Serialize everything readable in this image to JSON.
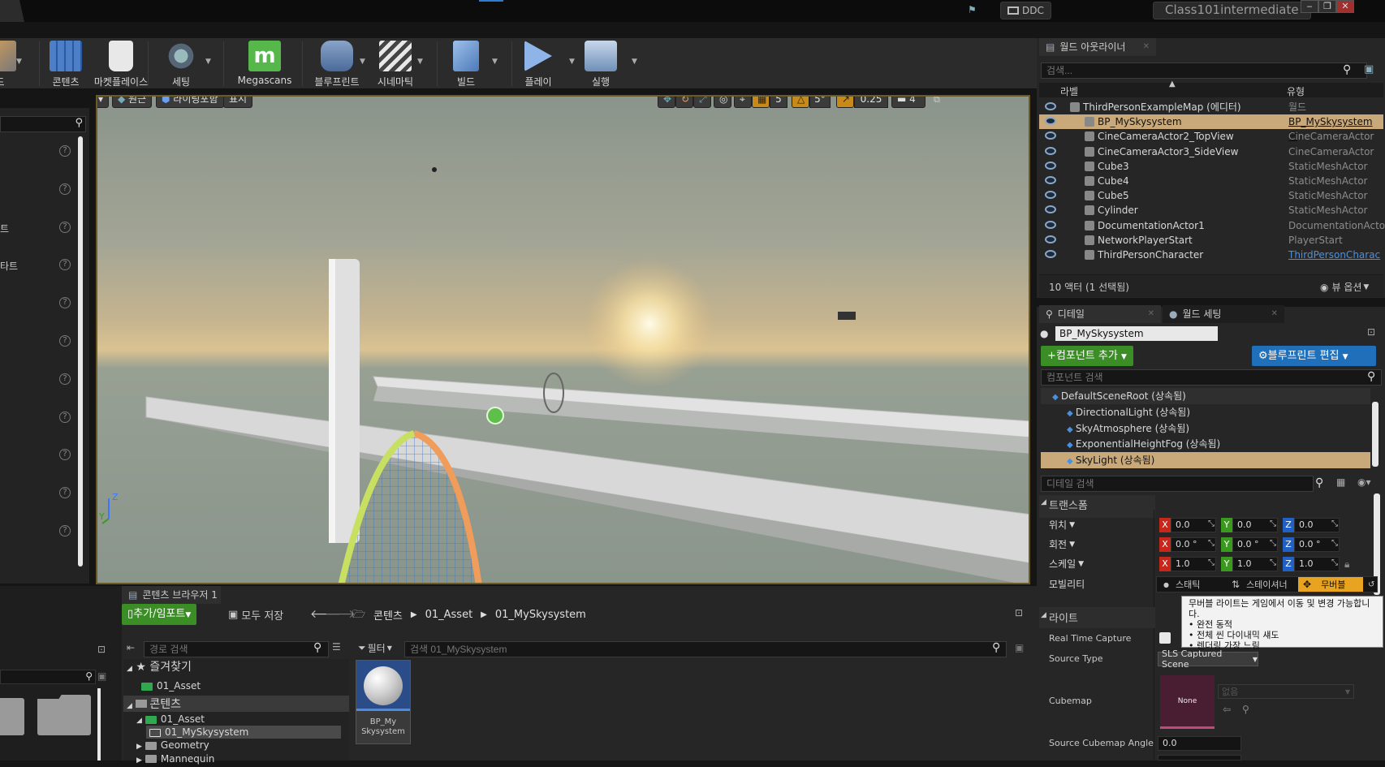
{
  "titlebar": {
    "ddc_label": "DDC",
    "project_name": "Class101intermediate",
    "minimize": "‒",
    "restore": "❐",
    "close": "✕"
  },
  "toolbar": {
    "items": [
      {
        "label": "드",
        "icon": "modes-icon"
      },
      {
        "label": "콘텐츠",
        "icon": "content-icon"
      },
      {
        "label": "마켓플레이스",
        "icon": "marketplace-icon"
      },
      {
        "label": "세팅",
        "icon": "settings-icon"
      },
      {
        "label": "Megascans",
        "icon": "megascans-icon"
      },
      {
        "label": "블루프린트",
        "icon": "blueprint-icon"
      },
      {
        "label": "시네마틱",
        "icon": "cinematics-icon"
      },
      {
        "label": "빌드",
        "icon": "build-icon"
      },
      {
        "label": "플레이",
        "icon": "play-icon"
      },
      {
        "label": "실행",
        "icon": "launch-icon"
      }
    ]
  },
  "left_panel": {
    "items": [
      "",
      "",
      "트",
      "타트",
      "",
      "",
      "",
      "",
      "",
      "",
      ""
    ]
  },
  "viewport": {
    "perspective_label": "원근",
    "lighting_label": "라이팅포함",
    "show_label": "표시",
    "grid_snap": "5",
    "rotation_snap": "5°",
    "scale_snap": "0.25",
    "camera_speed": "4",
    "axis_z": "Z",
    "axis_y": "Y"
  },
  "outliner": {
    "tab_label": "월드 아웃라이너",
    "search_placeholder": "검색...",
    "col_label": "라벨",
    "col_type": "유형",
    "rows": [
      {
        "label": "ThirdPersonExampleMap (에디터)",
        "type": "월드",
        "selected": false,
        "indent": 0
      },
      {
        "label": "BP_MySkysystem",
        "type": "BP_MySkysystem 편",
        "selected": true,
        "indent": 1
      },
      {
        "label": "CineCameraActor2_TopView",
        "type": "CineCameraActor",
        "selected": false,
        "indent": 1
      },
      {
        "label": "CineCameraActor3_SideView",
        "type": "CineCameraActor",
        "selected": false,
        "indent": 1
      },
      {
        "label": "Cube3",
        "type": "StaticMeshActor",
        "selected": false,
        "indent": 1
      },
      {
        "label": "Cube4",
        "type": "StaticMeshActor",
        "selected": false,
        "indent": 1
      },
      {
        "label": "Cube5",
        "type": "StaticMeshActor",
        "selected": false,
        "indent": 1
      },
      {
        "label": "Cylinder",
        "type": "StaticMeshActor",
        "selected": false,
        "indent": 1
      },
      {
        "label": "DocumentationActor1",
        "type": "DocumentationActor",
        "selected": false,
        "indent": 1
      },
      {
        "label": "NetworkPlayerStart",
        "type": "PlayerStart",
        "selected": false,
        "indent": 1
      },
      {
        "label": "ThirdPersonCharacter",
        "type": "ThirdPersonCharac",
        "selected": false,
        "indent": 1
      }
    ],
    "footer_count": "10 액터 (1 선택됨)",
    "view_options": "뷰 옵션"
  },
  "details": {
    "tab_details": "디테일",
    "tab_world_settings": "월드 세팅",
    "actor_name": "BP_MySkysystem",
    "add_component": "컴포넌트 추가",
    "edit_blueprint": "블루프린트 편집",
    "component_search_placeholder": "컴포넌트 검색",
    "components": [
      {
        "label": "DefaultSceneRoot (상속됨)",
        "indent": 0,
        "selected": false
      },
      {
        "label": "DirectionalLight (상속됨)",
        "indent": 1,
        "selected": false
      },
      {
        "label": "SkyAtmosphere (상속됨)",
        "indent": 1,
        "selected": false
      },
      {
        "label": "ExponentialHeightFog (상속됨)",
        "indent": 1,
        "selected": false
      },
      {
        "label": "SkyLight (상속됨)",
        "indent": 1,
        "selected": true
      }
    ],
    "detail_search_placeholder": "디테일 검색",
    "transform_header": "트랜스폼",
    "location_label": "위치",
    "rotation_label": "회전",
    "scale_label": "스케일",
    "mobility_label": "모빌리티",
    "location": {
      "x": "0.0",
      "y": "0.0",
      "z": "0.0"
    },
    "rotation": {
      "x": "0.0 °",
      "y": "0.0 °",
      "z": "0.0 °"
    },
    "scale": {
      "x": "1.0",
      "y": "1.0",
      "z": "1.0"
    },
    "mobility_options": [
      "스태틱",
      "스테이셔너",
      "무버블"
    ],
    "light_header": "라이트",
    "real_time_capture": "Real Time Capture",
    "source_type_label": "Source Type",
    "source_type_value": "SLS Captured Scene",
    "cubemap_label": "Cubemap",
    "cubemap_none": "None",
    "cubemap_value": "없음",
    "source_cubemap_angle_label": "Source Cubemap Angle",
    "source_cubemap_angle_value": "0.0",
    "axis_x": "X",
    "axis_y": "Y",
    "axis_z": "Z"
  },
  "tooltip": {
    "lines": [
      "무버블 라이트는 게임에서 이동 및 변경 가능합니다.",
      "• 완전 동적",
      "• 전체 씬 다이내믹 섀도",
      "• 렌더링 가장 느림"
    ]
  },
  "content_browser": {
    "tab_label": "콘텐츠 브라우저 1",
    "add_import": "추가/임포트",
    "save_all": "모두 저장",
    "breadcrumb": [
      "콘텐츠",
      "01_Asset",
      "01_MySkysystem"
    ],
    "path_search_placeholder": "경로 검색",
    "filter_label": "필터",
    "asset_search_placeholder": "검색 01_MySkysystem",
    "favorites_label": "즐겨찾기",
    "favorites_items": [
      "01_Asset"
    ],
    "content_label": "콘텐츠",
    "tree": [
      {
        "label": "01_Asset",
        "indent": 1,
        "selected": false
      },
      {
        "label": "01_MySkysystem",
        "indent": 2,
        "selected": true
      },
      {
        "label": "Geometry",
        "indent": 1,
        "selected": false
      },
      {
        "label": "Mannequin",
        "indent": 1,
        "selected": false
      }
    ],
    "asset": {
      "name": "BP_My Skysystem",
      "name_line1": "BP_My",
      "name_line2": "Skysystem"
    }
  },
  "colors": {
    "accent_yellow": "#f0b800",
    "selection_tan": "#c9a97a",
    "green_button": "#3a8e25",
    "blue_button": "#1f6fba",
    "axis_x_red": "#c7261b",
    "axis_y_green": "#3a9a1e",
    "axis_z_blue": "#2160c4"
  }
}
